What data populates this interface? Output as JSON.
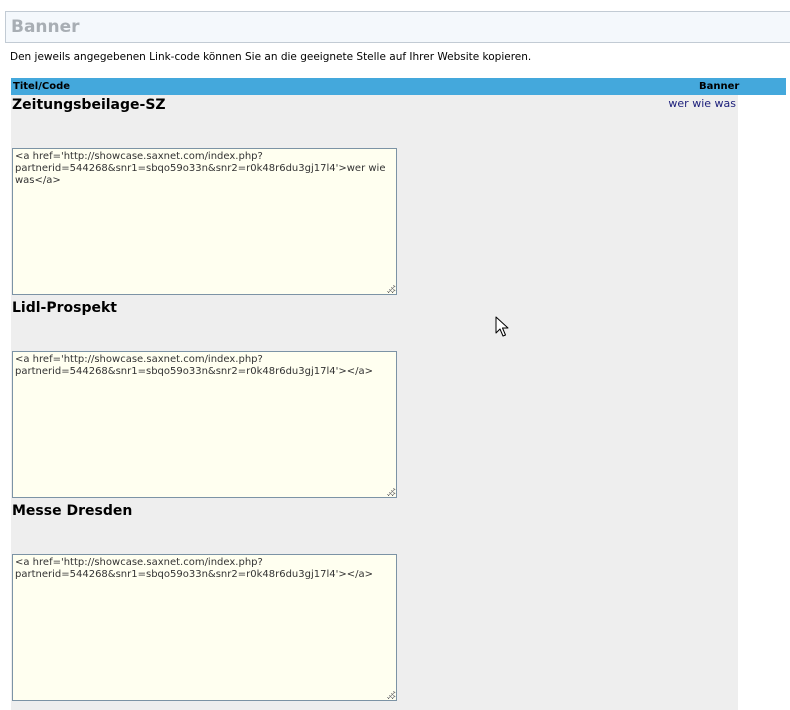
{
  "page": {
    "heading": "Banner",
    "intro": "Den jeweils angegebenen Link-code können Sie an die geeignete Stelle auf Ihrer Website kopieren."
  },
  "table": {
    "col_title": "Titel/Code",
    "col_banner": "Banner",
    "rows": [
      {
        "title": "Zeitungsbeilage-SZ",
        "banner_text": "wer wie was",
        "code": "<a href='http://showcase.saxnet.com/index.php?partnerid=544268&snr1=sbqo59o33n&snr2=r0k48r6du3gj17l4'>wer wie was</a>"
      },
      {
        "title": "Lidl-Prospekt",
        "banner_text": "",
        "code": "<a href='http://showcase.saxnet.com/index.php?partnerid=544268&snr1=sbqo59o33n&snr2=r0k48r6du3gj17l4'></a>"
      },
      {
        "title": "Messe Dresden",
        "banner_text": "",
        "code": "<a href='http://showcase.saxnet.com/index.php?partnerid=544268&snr1=sbqo59o33n&snr2=r0k48r6du3gj17l4'></a>"
      }
    ]
  },
  "colors": {
    "header_bar": "#44a8dc",
    "row_background": "#eeeeee",
    "code_background": "#fffff0",
    "link": "#1b1e7a"
  },
  "icons": {
    "pointer": "mouse-pointer-icon",
    "resize": "resize-grip-icon"
  }
}
